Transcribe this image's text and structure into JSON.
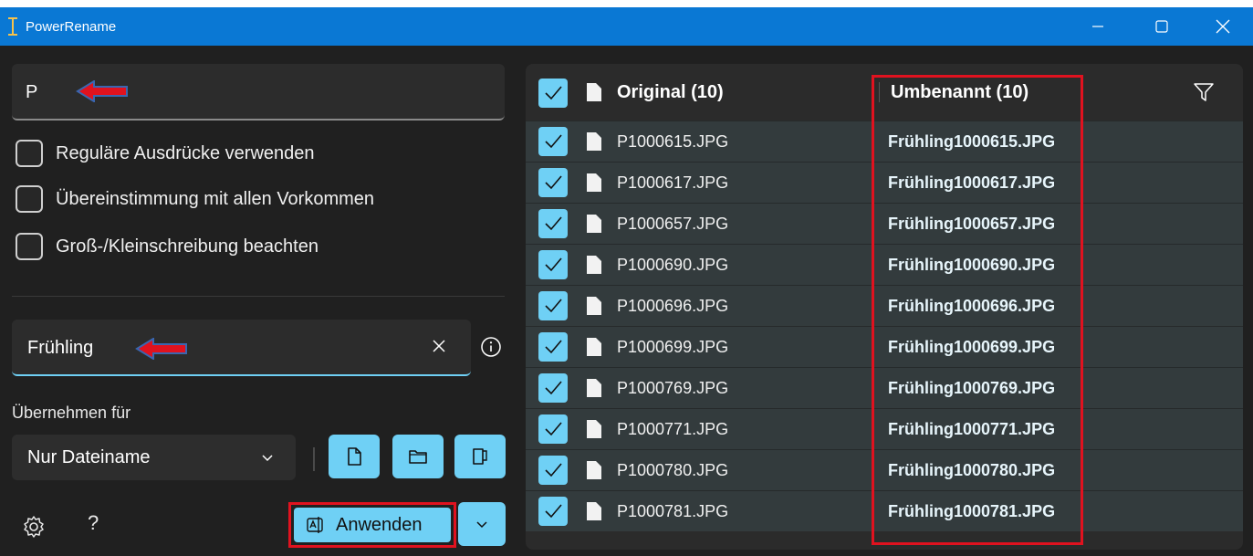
{
  "window": {
    "title": "PowerRename"
  },
  "search": {
    "value": "P"
  },
  "options": [
    {
      "label": "Reguläre Ausdrücke verwenden",
      "checked": false
    },
    {
      "label": "Übereinstimmung mit allen Vorkommen",
      "checked": false
    },
    {
      "label": "Groß-/Kleinschreibung beachten",
      "checked": false
    }
  ],
  "replace": {
    "value": "Frühling"
  },
  "apply_for": {
    "label": "Übernehmen für",
    "selected": "Nur Dateiname"
  },
  "actions": {
    "apply_label": "Anwenden"
  },
  "table": {
    "header_original": "Original (10)",
    "header_renamed": "Umbenannt (10)",
    "rows": [
      {
        "original": "P1000615.JPG",
        "renamed": "Frühling1000615.JPG"
      },
      {
        "original": "P1000617.JPG",
        "renamed": "Frühling1000617.JPG"
      },
      {
        "original": "P1000657.JPG",
        "renamed": "Frühling1000657.JPG"
      },
      {
        "original": "P1000690.JPG",
        "renamed": "Frühling1000690.JPG"
      },
      {
        "original": "P1000696.JPG",
        "renamed": "Frühling1000696.JPG"
      },
      {
        "original": "P1000699.JPG",
        "renamed": "Frühling1000699.JPG"
      },
      {
        "original": "P1000769.JPG",
        "renamed": "Frühling1000769.JPG"
      },
      {
        "original": "P1000771.JPG",
        "renamed": "Frühling1000771.JPG"
      },
      {
        "original": "P1000780.JPG",
        "renamed": "Frühling1000780.JPG"
      },
      {
        "original": "P1000781.JPG",
        "renamed": "Frühling1000781.JPG"
      }
    ]
  },
  "colors": {
    "accent": "#6fd0f5",
    "titlebar": "#0a78d4",
    "highlight": "#e0121f",
    "background": "#202020"
  },
  "icons": [
    "powerrename-icon",
    "minimize-icon",
    "maximize-icon",
    "close-icon",
    "arrow-left-icon",
    "clear-icon",
    "info-icon",
    "chevron-down-icon",
    "file-icon",
    "folder-icon",
    "file-and-folder-icon",
    "settings-icon",
    "help-icon",
    "rename-icon",
    "filter-icon",
    "checkmark-icon"
  ]
}
